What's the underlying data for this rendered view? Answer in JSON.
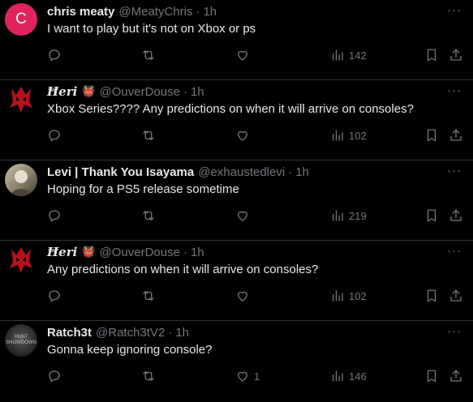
{
  "tweets": [
    {
      "avatar_kind": "letter",
      "avatar_letter": "C",
      "avatar_color": "#e0245e",
      "name": "chris meaty",
      "badge": "",
      "handle": "@MeatyChris",
      "time": "1h",
      "text": "I want to play but it's not on Xbox or ps",
      "likes": "",
      "views": "142"
    },
    {
      "avatar_kind": "red",
      "name": "Ħeri",
      "badge": "👹",
      "handle": "@OuverDouse",
      "time": "1h",
      "text": "Xbox Series???? Any predictions on when it will arrive on consoles?",
      "likes": "",
      "views": "102"
    },
    {
      "avatar_kind": "photo",
      "name": "Levi | Thank You Isayama",
      "badge": "",
      "handle": "@exhaustedlevi",
      "time": "1h",
      "text": "Hoping for a PS5 release sometime",
      "likes": "",
      "views": "219"
    },
    {
      "avatar_kind": "red",
      "name": "Ħeri",
      "badge": "👹",
      "handle": "@OuverDouse",
      "time": "1h",
      "text": "Any predictions on when it will arrive on consoles?",
      "likes": "",
      "views": "102"
    },
    {
      "avatar_kind": "dark",
      "avatar_caption": "HUNT SHOWDOWN",
      "name": "Ratch3t",
      "badge": "",
      "handle": "@Ratch3tV2",
      "time": "1h",
      "text": "Gonna keep ignoring console?",
      "likes": "1",
      "views": "146"
    }
  ],
  "ui": {
    "separator": "·",
    "more": "···"
  },
  "icons": {
    "reply": "reply-icon",
    "retweet": "retweet-icon",
    "like": "heart-icon",
    "views": "views-icon",
    "bookmark": "bookmark-icon",
    "share": "share-icon"
  },
  "colors": {
    "background": "#000000",
    "text": "#e7e9ea",
    "muted": "#71767b",
    "divider": "#2f3336"
  }
}
